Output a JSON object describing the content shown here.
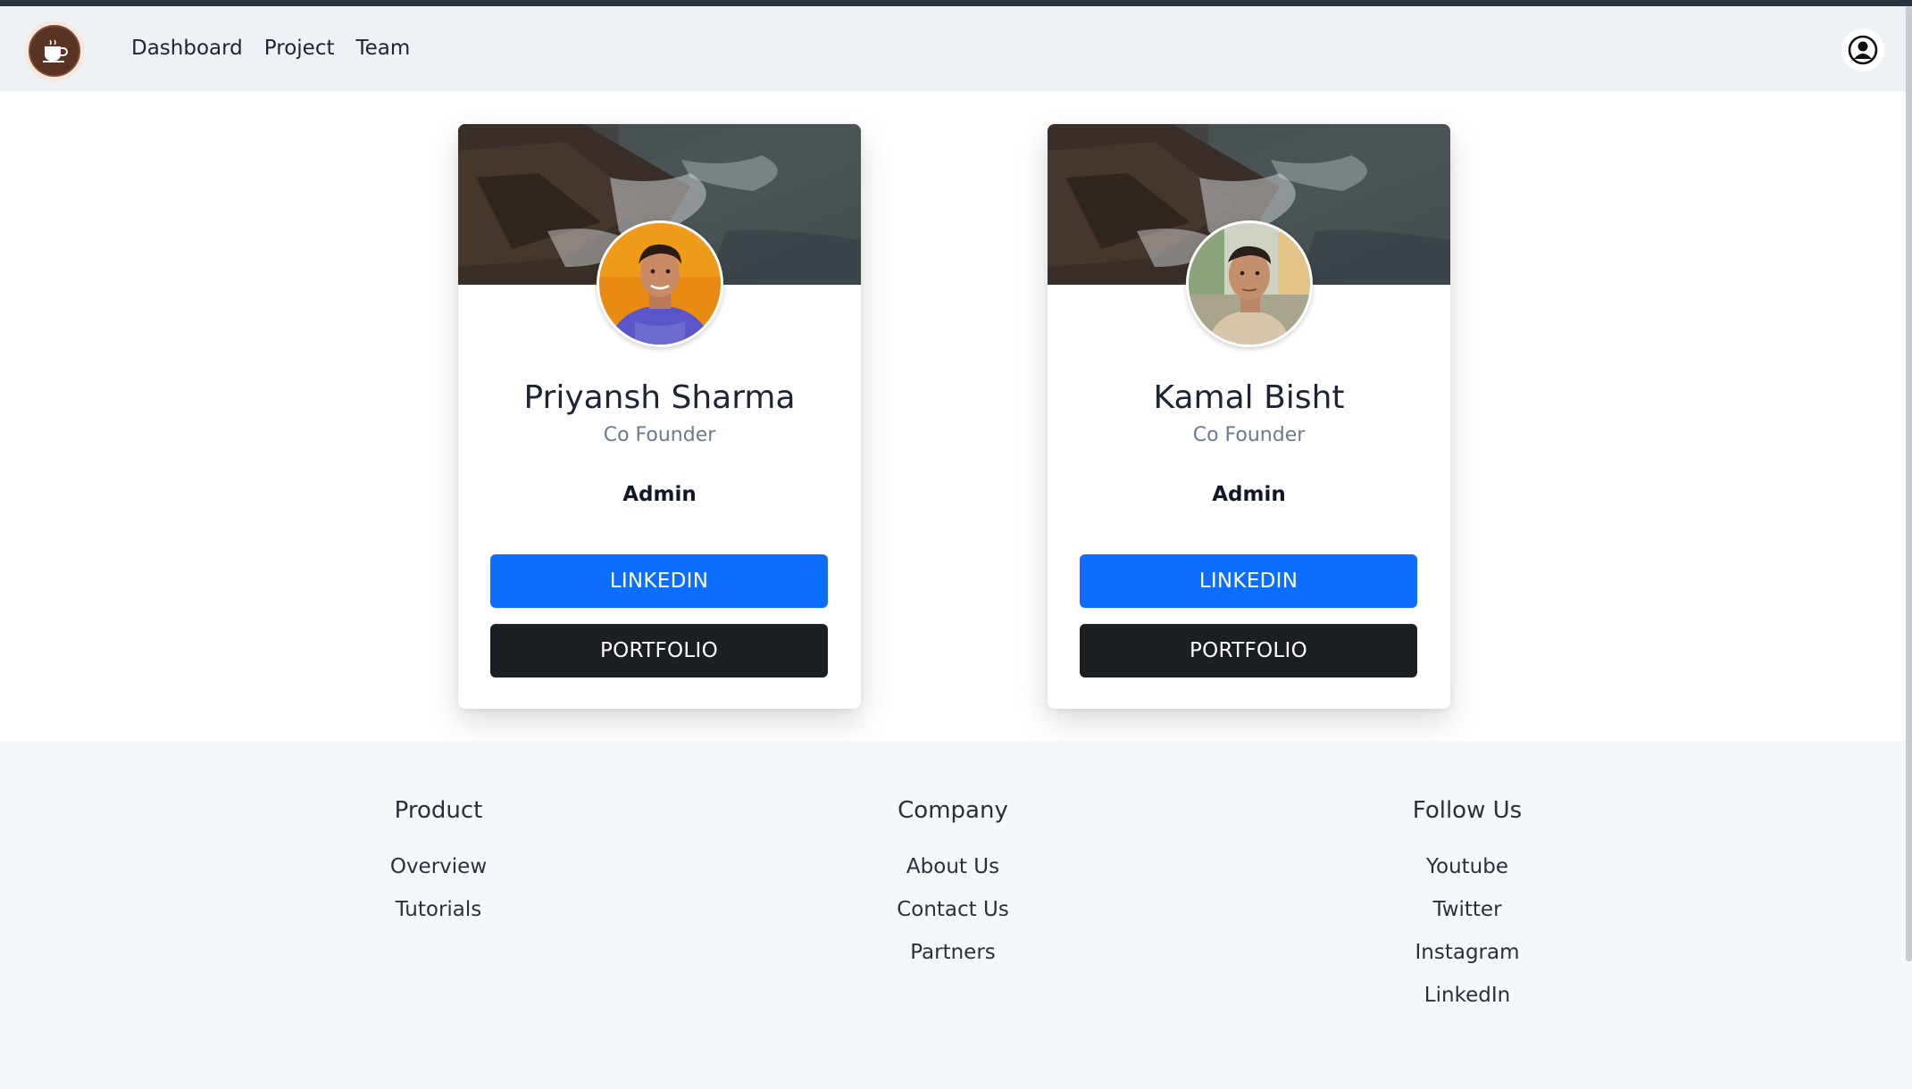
{
  "nav": {
    "links": [
      {
        "label": "Dashboard"
      },
      {
        "label": "Project"
      },
      {
        "label": "Team"
      }
    ]
  },
  "cards": [
    {
      "name": "Priyansh Sharma",
      "role": "Co Founder",
      "badge": "Admin",
      "linkedin_label": "LINKEDIN",
      "portfolio_label": "PORTFOLIO"
    },
    {
      "name": "Kamal Bisht",
      "role": "Co Founder",
      "badge": "Admin",
      "linkedin_label": "LINKEDIN",
      "portfolio_label": "PORTFOLIO"
    }
  ],
  "footer": {
    "columns": [
      {
        "title": "Product",
        "items": [
          "Overview",
          "Tutorials"
        ]
      },
      {
        "title": "Company",
        "items": [
          "About Us",
          "Contact Us",
          "Partners"
        ]
      },
      {
        "title": "Follow Us",
        "items": [
          "Youtube",
          "Twitter",
          "Instagram",
          "LinkedIn"
        ]
      }
    ]
  },
  "colors": {
    "primary": "#0d6efd",
    "dark": "#1b1f23",
    "navbar_bg": "#eef2f6",
    "footer_bg": "#f5f8fb",
    "muted_text": "#6b7a8c"
  },
  "icons": {
    "logo": "coffee-cup-icon",
    "profile": "user-circle-icon"
  }
}
